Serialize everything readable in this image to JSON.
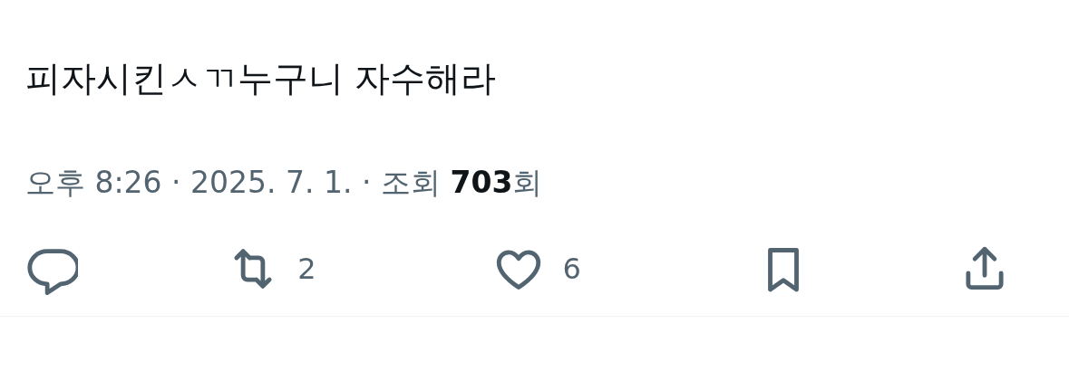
{
  "tweet": {
    "text": "피자시킨ㅅㄲ누구니 자수해라",
    "meta": "오후 8:26 · 2025. 7. 1. · 조회 **703**회"
  },
  "actions": [
    {
      "kind": "reply"
    },
    {
      "kind": "repost",
      "count": "2"
    },
    {
      "kind": "like",
      "count": "6"
    },
    {
      "kind": "bookmark"
    },
    {
      "kind": "share"
    }
  ]
}
